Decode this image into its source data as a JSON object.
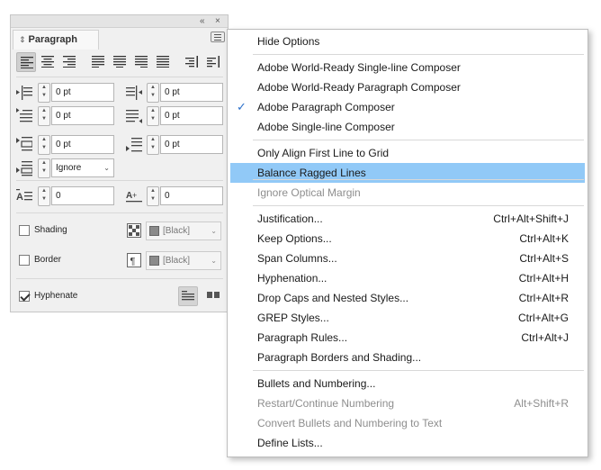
{
  "panel": {
    "title": "Paragraph",
    "titlebar_icons": {
      "collapse": "«",
      "close": "×"
    },
    "alignment_buttons": [
      "align-left",
      "align-center",
      "align-right",
      "justify-left",
      "justify-center",
      "justify-right",
      "justify-all",
      "align-towards-spine",
      "align-away-from-spine"
    ],
    "left_indent": "0 pt",
    "right_indent": "0 pt",
    "first_line_indent": "0 pt",
    "last_line_indent": "0 pt",
    "space_before": "0 pt",
    "space_after": "0 pt",
    "align_to_grid": "Ignore",
    "drop_cap_lines": "0",
    "drop_cap_chars": "0",
    "shading": {
      "label": "Shading",
      "checked": false,
      "color": "[Black]"
    },
    "border": {
      "label": "Border",
      "checked": false,
      "color": "[Black]"
    },
    "hyphenate": {
      "label": "Hyphenate",
      "checked": true
    }
  },
  "menu": {
    "items": [
      {
        "label": "Hide Options",
        "shortcut": "",
        "disabled": false
      },
      {
        "label": "Adobe World-Ready Single-line Composer",
        "shortcut": "",
        "disabled": false
      },
      {
        "label": "Adobe World-Ready Paragraph Composer",
        "shortcut": "",
        "disabled": false
      },
      {
        "label": "Adobe Paragraph Composer",
        "shortcut": "",
        "disabled": false,
        "checked": true
      },
      {
        "label": "Adobe Single-line Composer",
        "shortcut": "",
        "disabled": false
      },
      {
        "label": "Only Align First Line to Grid",
        "shortcut": "",
        "disabled": false
      },
      {
        "label": "Balance Ragged Lines",
        "shortcut": "",
        "disabled": false,
        "highlighted": true
      },
      {
        "label": "Ignore Optical Margin",
        "shortcut": "",
        "disabled": true
      },
      {
        "label": "Justification...",
        "shortcut": "Ctrl+Alt+Shift+J",
        "disabled": false
      },
      {
        "label": "Keep Options...",
        "shortcut": "Ctrl+Alt+K",
        "disabled": false
      },
      {
        "label": "Span Columns...",
        "shortcut": "Ctrl+Alt+S",
        "disabled": false
      },
      {
        "label": "Hyphenation...",
        "shortcut": "Ctrl+Alt+H",
        "disabled": false
      },
      {
        "label": "Drop Caps and Nested Styles...",
        "shortcut": "Ctrl+Alt+R",
        "disabled": false
      },
      {
        "label": "GREP Styles...",
        "shortcut": "Ctrl+Alt+G",
        "disabled": false
      },
      {
        "label": "Paragraph Rules...",
        "shortcut": "Ctrl+Alt+J",
        "disabled": false
      },
      {
        "label": "Paragraph Borders and Shading...",
        "shortcut": "",
        "disabled": false
      },
      {
        "label": "Bullets and Numbering...",
        "shortcut": "",
        "disabled": false
      },
      {
        "label": "Restart/Continue Numbering",
        "shortcut": "Alt+Shift+R",
        "disabled": true
      },
      {
        "label": "Convert Bullets and Numbering to Text",
        "shortcut": "",
        "disabled": true
      },
      {
        "label": "Define Lists...",
        "shortcut": "",
        "disabled": false
      }
    ],
    "checkmark": "✓"
  },
  "colors": {
    "highlight": "#91c9f7",
    "panel_bg": "#f0f0f0",
    "disabled_text": "#8e8e8e"
  }
}
